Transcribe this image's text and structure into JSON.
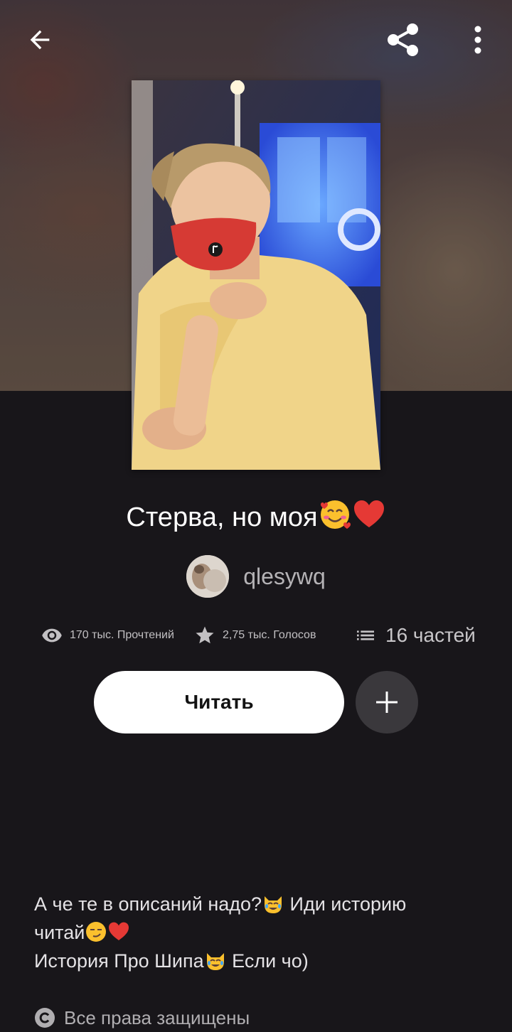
{
  "toolbar": {
    "back_icon": "arrow-left-icon",
    "share_icon": "share-icon",
    "more_icon": "more-vertical-icon"
  },
  "story": {
    "title": "Стерва, но моя",
    "title_emojis": [
      "smiling-face-with-hearts-emoji",
      "red-heart-emoji"
    ],
    "author": "qlesywq"
  },
  "stats": {
    "reads": "170 тыс. Прочтений",
    "votes": "2,75 тыс. Голосов",
    "parts": "16 частей"
  },
  "actions": {
    "read_label": "Читать",
    "add_icon": "plus-icon"
  },
  "description": {
    "line1": "А че те в описаний надо?",
    "line1b": " Иди историю",
    "line2": "читай",
    "line3": "История Про Шипа",
    "line3b": " Если чо)"
  },
  "copyright": {
    "label": "Все права защищены",
    "icon": "copyright-icon"
  },
  "colors": {
    "background": "#18161a",
    "primary_button": "#ffffff",
    "secondary_button": "#3a383c",
    "muted_text": "#b5b3b6"
  }
}
